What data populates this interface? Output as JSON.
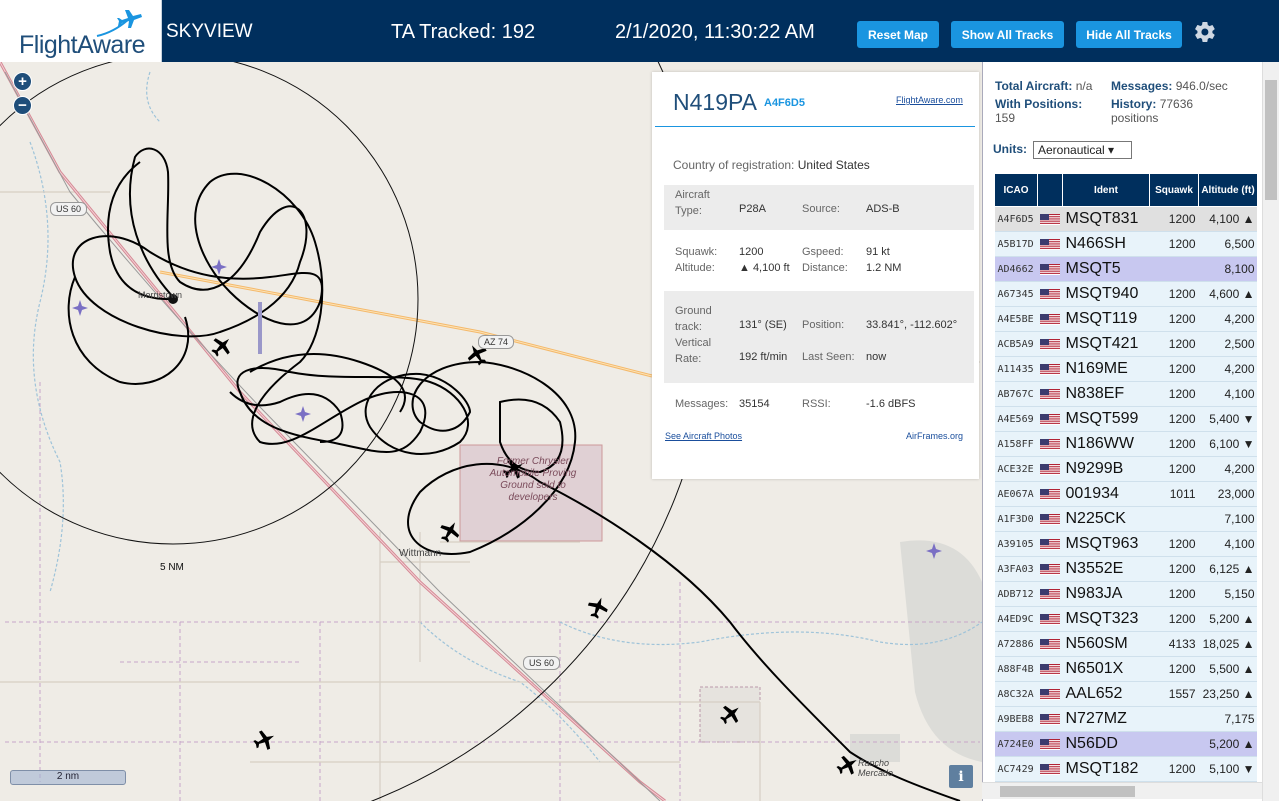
{
  "header": {
    "logo_text": "FlightAware",
    "app_name": "SKYVIEW",
    "ta_tracked": "TA Tracked: 192",
    "clock": "2/1/2020, 11:30:22 AM",
    "reset_label": "Reset Map",
    "show_label": "Show All Tracks",
    "hide_label": "Hide All Tracks"
  },
  "map": {
    "zoom_in": "+",
    "zoom_out": "−",
    "labels": {
      "us60_top": "US 60",
      "az74": "AZ 74",
      "us60_bottom": "US 60",
      "morristown": "Morristown",
      "wittmann": "Wittmann",
      "former_chrysler": "Former Chrysler Automobile Proving Ground sold to developers",
      "range_ring": "5 NM",
      "rancho_mercado": "Rancho Mercado"
    },
    "scale": "2 nm",
    "info": "i"
  },
  "detail": {
    "registration": "N419PA",
    "icao": "A4F6D5",
    "fa_link": "FlightAware.com",
    "country_label": "Country of registration:",
    "country": "United States",
    "aircraft_type_label": "Aircraft Type:",
    "aircraft_type": "P28A",
    "source_label": "Source:",
    "source": "ADS-B",
    "squawk_label": "Squawk:",
    "squawk": "1200",
    "gspeed_label": "Gspeed:",
    "gspeed": "91 kt",
    "altitude_label": "Altitude:",
    "altitude": "▲ 4,100 ft",
    "distance_label": "Distance:",
    "distance": "1.2 NM",
    "ground_track_label": "Ground track:",
    "ground_track": "131° (SE)",
    "position_label": "Position:",
    "position": "33.841°, -112.602°",
    "vertical_rate_label": "Vertical Rate:",
    "vertical_rate": "192 ft/min",
    "last_seen_label": "Last Seen:",
    "last_seen": "now",
    "messages_label": "Messages:",
    "messages": "35154",
    "rssi_label": "RSSI:",
    "rssi": "-1.6 dBFS",
    "photos_link": "See Aircraft Photos",
    "airframes_link": "AirFrames.org"
  },
  "panel": {
    "total_aircraft_label": "Total Aircraft:",
    "total_aircraft": "n/a",
    "messages_label": "Messages:",
    "messages": "946.0/sec",
    "with_positions_label": "With Positions:",
    "with_positions": "159",
    "history_label": "History:",
    "history": "77636 positions",
    "units_label": "Units:",
    "units_value": "Aeronautical ▾"
  },
  "table": {
    "headers": [
      "ICAO",
      "",
      "Ident",
      "Squawk",
      "Altitude (ft)"
    ],
    "rows": [
      {
        "icao": "A4F6D5",
        "ident": "MSQT831",
        "squawk": "1200",
        "alt": "4,100 ▲"
      },
      {
        "icao": "A5B17D",
        "ident": "N466SH",
        "squawk": "1200",
        "alt": "6,500"
      },
      {
        "icao": "AD4662",
        "ident": "MSQT5",
        "squawk": "",
        "alt": "8,100"
      },
      {
        "icao": "A67345",
        "ident": "MSQT940",
        "squawk": "1200",
        "alt": "4,600 ▲"
      },
      {
        "icao": "A4E5BE",
        "ident": "MSQT119",
        "squawk": "1200",
        "alt": "4,200"
      },
      {
        "icao": "ACB5A9",
        "ident": "MSQT421",
        "squawk": "1200",
        "alt": "2,500"
      },
      {
        "icao": "A11435",
        "ident": "N169ME",
        "squawk": "1200",
        "alt": "4,200"
      },
      {
        "icao": "AB767C",
        "ident": "N838EF",
        "squawk": "1200",
        "alt": "4,100"
      },
      {
        "icao": "A4E569",
        "ident": "MSQT599",
        "squawk": "1200",
        "alt": "5,400 ▼"
      },
      {
        "icao": "A158FF",
        "ident": "N186WW",
        "squawk": "1200",
        "alt": "6,100 ▼"
      },
      {
        "icao": "ACE32E",
        "ident": "N9299B",
        "squawk": "1200",
        "alt": "4,200"
      },
      {
        "icao": "AE067A",
        "ident": "001934",
        "squawk": "1011",
        "alt": "23,000"
      },
      {
        "icao": "A1F3D0",
        "ident": "N225CK",
        "squawk": "",
        "alt": "7,100"
      },
      {
        "icao": "A39105",
        "ident": "MSQT963",
        "squawk": "1200",
        "alt": "4,100"
      },
      {
        "icao": "A3FA03",
        "ident": "N3552E",
        "squawk": "1200",
        "alt": "6,125 ▲"
      },
      {
        "icao": "ADB712",
        "ident": "N983JA",
        "squawk": "1200",
        "alt": "5,150"
      },
      {
        "icao": "A4ED9C",
        "ident": "MSQT323",
        "squawk": "1200",
        "alt": "5,200 ▲"
      },
      {
        "icao": "A72886",
        "ident": "N560SM",
        "squawk": "4133",
        "alt": "18,025 ▲"
      },
      {
        "icao": "A88F4B",
        "ident": "N6501X",
        "squawk": "1200",
        "alt": "5,500 ▲"
      },
      {
        "icao": "A8C32A",
        "ident": "AAL652",
        "squawk": "1557",
        "alt": "23,250 ▲"
      },
      {
        "icao": "A9BEB8",
        "ident": "N727MZ",
        "squawk": "",
        "alt": "7,175"
      },
      {
        "icao": "A724E0",
        "ident": "N56DD",
        "squawk": "",
        "alt": "5,200 ▲"
      },
      {
        "icao": "AC7429",
        "ident": "MSQT182",
        "squawk": "1200",
        "alt": "5,100 ▼"
      }
    ]
  },
  "colors": {
    "header_bg": "#002f5d",
    "button_bg": "#1a95e0",
    "selected_row": "#c8c8f0",
    "row_bg": "#e8f3fa"
  }
}
